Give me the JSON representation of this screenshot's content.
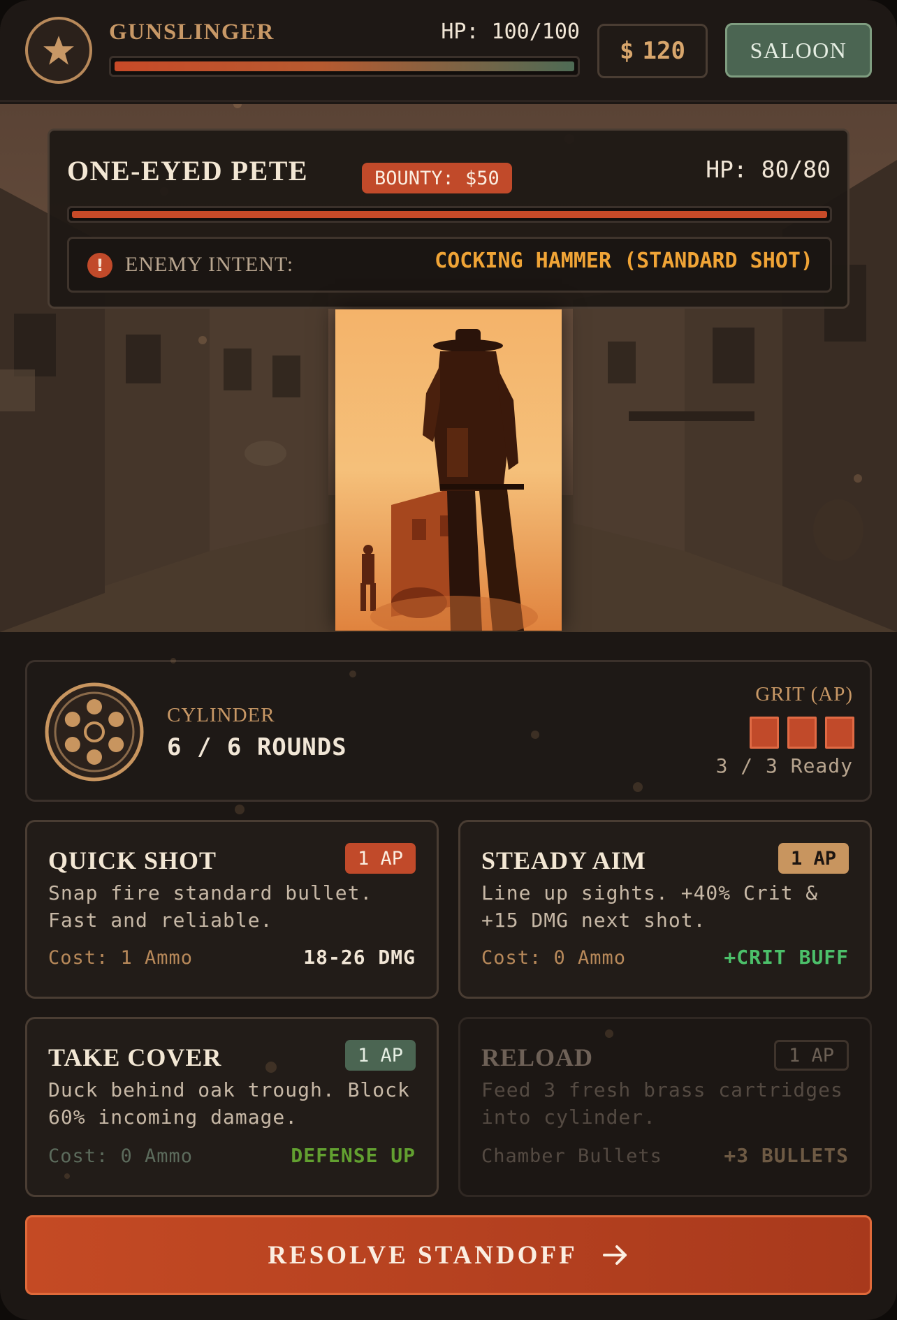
{
  "player": {
    "class_name": "GUNSLINGER",
    "hp_text": "HP: 100/100",
    "hp_fraction": 1.0,
    "gold_symbol": "$",
    "gold": "120"
  },
  "nav": {
    "saloon_label": "SALOON"
  },
  "enemy": {
    "name": "ONE-EYED PETE",
    "bounty": "BOUNTY: $50",
    "hp_text": "HP: 80/80",
    "hp_fraction": 1.0,
    "intent_icon": "!",
    "intent_label": "ENEMY INTENT:",
    "intent_value": "COCKING HAMMER (STANDARD SHOT)"
  },
  "status": {
    "cylinder_label": "CYLINDER",
    "cylinder_value": "6 / 6 ROUNDS",
    "rounds_loaded": 6,
    "grit_label": "GRIT (AP)",
    "grit_current": 3,
    "grit_ready": "3 / 3 Ready"
  },
  "actions": [
    {
      "title": "QUICK SHOT",
      "ap": "1 AP",
      "desc": "Snap fire standard bullet. Fast and reliable.",
      "cost": "Cost: 1 Ammo",
      "effect": "18-26 DMG"
    },
    {
      "title": "STEADY AIM",
      "ap": "1 AP",
      "desc": "Line up sights. +40% Crit & +15 DMG next shot.",
      "cost": "Cost: 0 Ammo",
      "effect": "+CRIT BUFF"
    },
    {
      "title": "TAKE COVER",
      "ap": "1 AP",
      "desc": "Duck behind oak trough. Block 60% incoming damage.",
      "cost": "Cost: 0 Ammo",
      "effect": "DEFENSE UP"
    },
    {
      "title": "RELOAD",
      "ap": "1 AP",
      "desc": "Feed 3 fresh brass cartridges into cylinder.",
      "cost": "Chamber Bullets",
      "effect": "+3 BULLETS",
      "disabled": true
    }
  ],
  "resolve_label": "RESOLVE STANDOFF",
  "icons": {
    "badge": "star-icon",
    "intent": "alert-icon",
    "cylinder": "revolver-cylinder-icon",
    "resolve": "arrow-right-icon"
  },
  "colors": {
    "accent_red": "#c14a2a",
    "gold": "#c89866",
    "green": "#4b6552",
    "intent_orange": "#f0a436",
    "crit_green": "#4cc06a"
  }
}
